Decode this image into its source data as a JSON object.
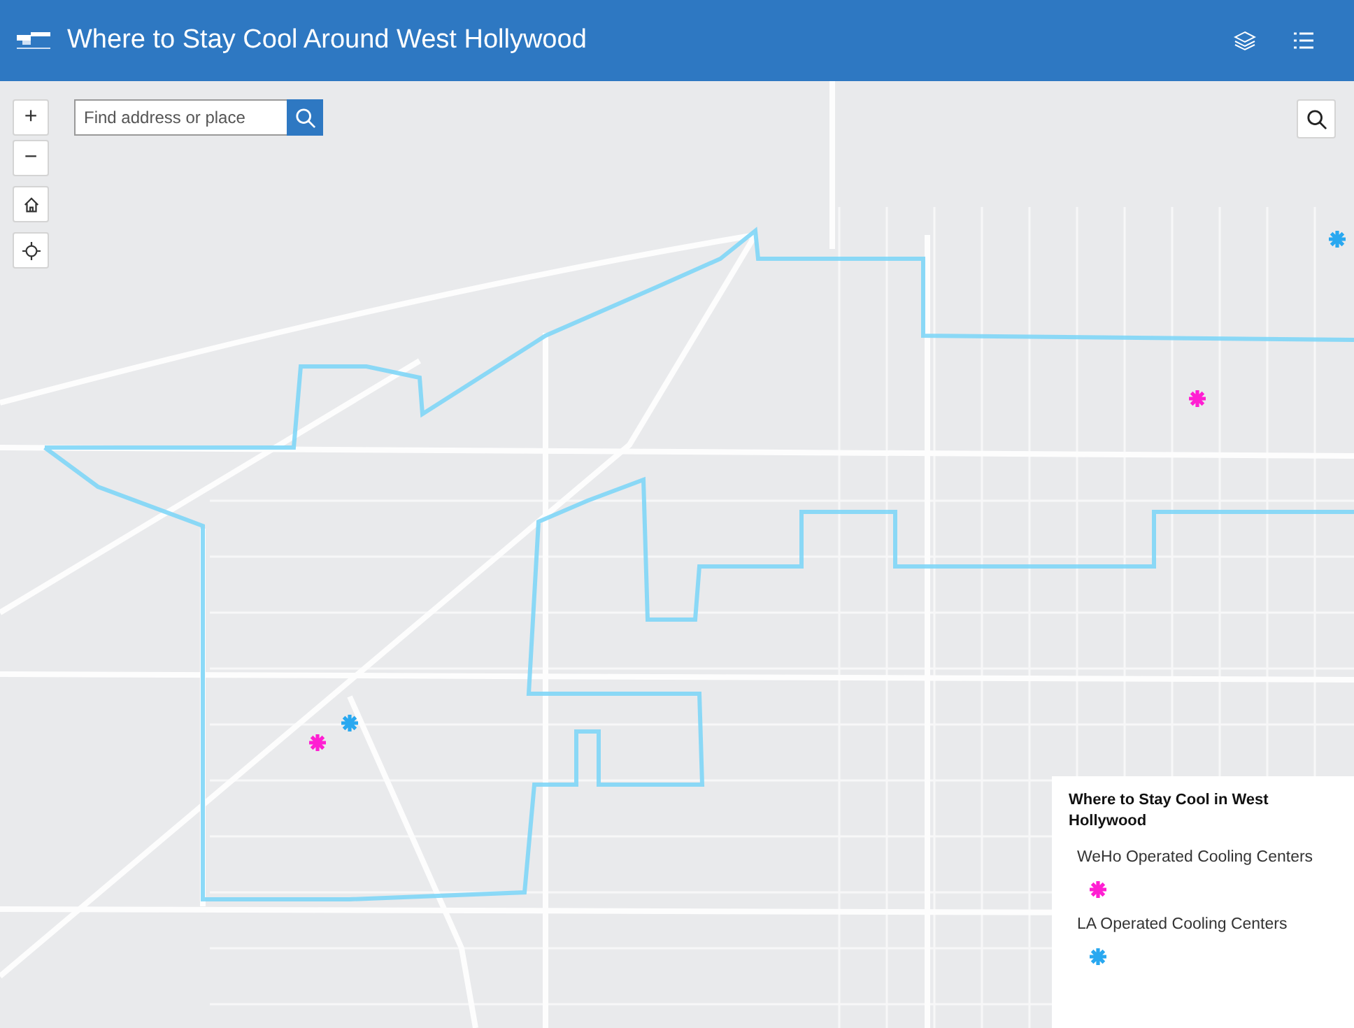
{
  "header": {
    "title": "Where to Stay Cool Around West Hollywood"
  },
  "search": {
    "placeholder": "Find address or place"
  },
  "zoom_controls": [
    "+",
    "−"
  ],
  "legend": {
    "title": "Where to Stay Cool in West Hollywood",
    "layers": [
      {
        "label": "WeHo Operated Cooling Centers",
        "color": "#ff1fd2"
      },
      {
        "label": "LA Operated Cooling Centers",
        "color": "#29a8f0"
      }
    ]
  }
}
